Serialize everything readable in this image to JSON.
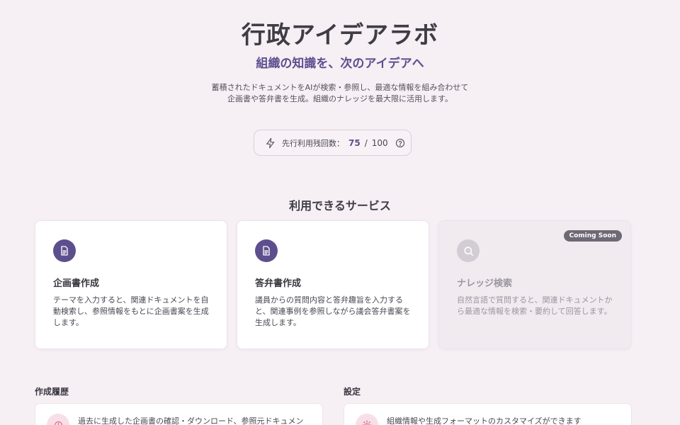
{
  "hero": {
    "title": "行政アイデアラボ",
    "subtitle": "組織の知識を、次のアイデアへ",
    "description_line1": "蓄積されたドキュメントをAIが検索・参照し、最適な情報を組み合わせて",
    "description_line2": "企画書や答弁書を生成。組織のナレッジを最大限に活用します。"
  },
  "quota": {
    "icon": "bolt-icon",
    "label": "先行利用残回数：",
    "remaining": "75",
    "separator": "/",
    "total": "100",
    "help_icon": "help-icon"
  },
  "services": {
    "title": "利用できるサービス",
    "cards": [
      {
        "icon": "document-icon",
        "title": "企画書作成",
        "description": "テーマを入力すると、関連ドキュメントを自動検索し、参照情報をもとに企画書案を生成します。"
      },
      {
        "icon": "document-icon",
        "title": "答弁書作成",
        "description": "議員からの質問内容と答弁趣旨を入力すると、関連事例を参照しながら議会答弁書案を生成します。"
      },
      {
        "icon": "search-icon",
        "title": "ナレッジ検索",
        "description": "自然言語で質問すると、関連ドキュメントから最適な情報を検索・要約して回答します。",
        "badge": "Coming Soon"
      }
    ]
  },
  "history": {
    "title": "作成履歴",
    "text": "過去に生成した企画書の確認・ダウンロード、参照元ドキュメン"
  },
  "settings": {
    "title": "設定",
    "text": "組織情報や生成フォーマットのカスタマイズができます"
  },
  "colors": {
    "background": "#f6eff4",
    "accent": "#5d4f8e",
    "badge": "#6f6975"
  }
}
